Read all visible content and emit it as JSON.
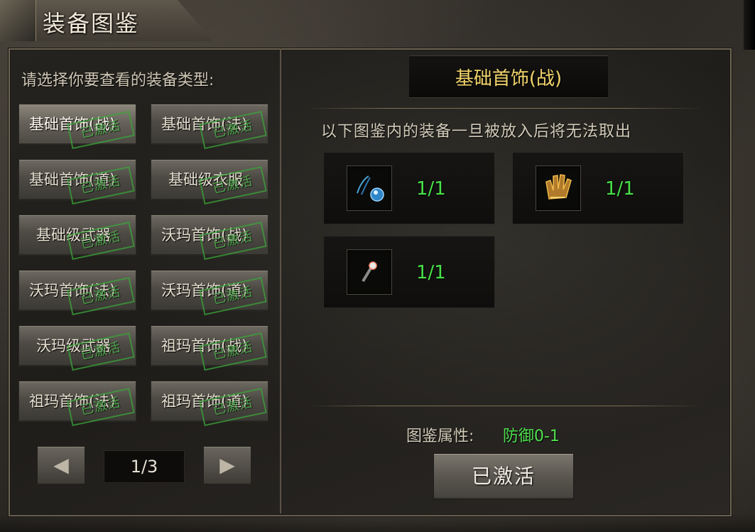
{
  "window": {
    "title": "装备图鉴"
  },
  "left": {
    "prompt": "请选择你要查看的装备类型:",
    "categories": [
      {
        "label": "基础首饰(战)",
        "stamp": "已激活",
        "selected": true
      },
      {
        "label": "基础首饰(法)",
        "stamp": "已激活",
        "selected": false
      },
      {
        "label": "基础首饰(道)",
        "stamp": "已激活",
        "selected": false
      },
      {
        "label": "基础级衣服",
        "stamp": "已激活",
        "selected": false
      },
      {
        "label": "基础级武器",
        "stamp": "已激活",
        "selected": false
      },
      {
        "label": "沃玛首饰(战)",
        "stamp": "已激活",
        "selected": false
      },
      {
        "label": "沃玛首饰(法)",
        "stamp": "已激活",
        "selected": false
      },
      {
        "label": "沃玛首饰(道)",
        "stamp": "已激活",
        "selected": false
      },
      {
        "label": "沃玛级武器",
        "stamp": "已激活",
        "selected": false
      },
      {
        "label": "祖玛首饰(战)",
        "stamp": "已激活",
        "selected": false
      },
      {
        "label": "祖玛首饰(法)",
        "stamp": "已激活",
        "selected": false
      },
      {
        "label": "祖玛首饰(道)",
        "stamp": "已激活",
        "selected": false
      }
    ],
    "pager": {
      "prev": "◀",
      "page": "1/3",
      "next": "▶"
    }
  },
  "right": {
    "title": "基础首饰(战)",
    "notice": "以下图鉴内的装备一旦被放入后将无法取出",
    "items": [
      {
        "icon": "necklace-icon",
        "count": "1/1"
      },
      {
        "icon": "glove-icon",
        "count": "1/1"
      },
      {
        "icon": "ring-icon",
        "count": "1/1"
      }
    ],
    "attr_label": "图鉴属性:",
    "attr_value": "防御0-1",
    "activate_label": "已激活"
  },
  "colors": {
    "accent_gold": "#f3d56a",
    "count_green": "#48e048",
    "stamp_green": "#3aa53a"
  }
}
